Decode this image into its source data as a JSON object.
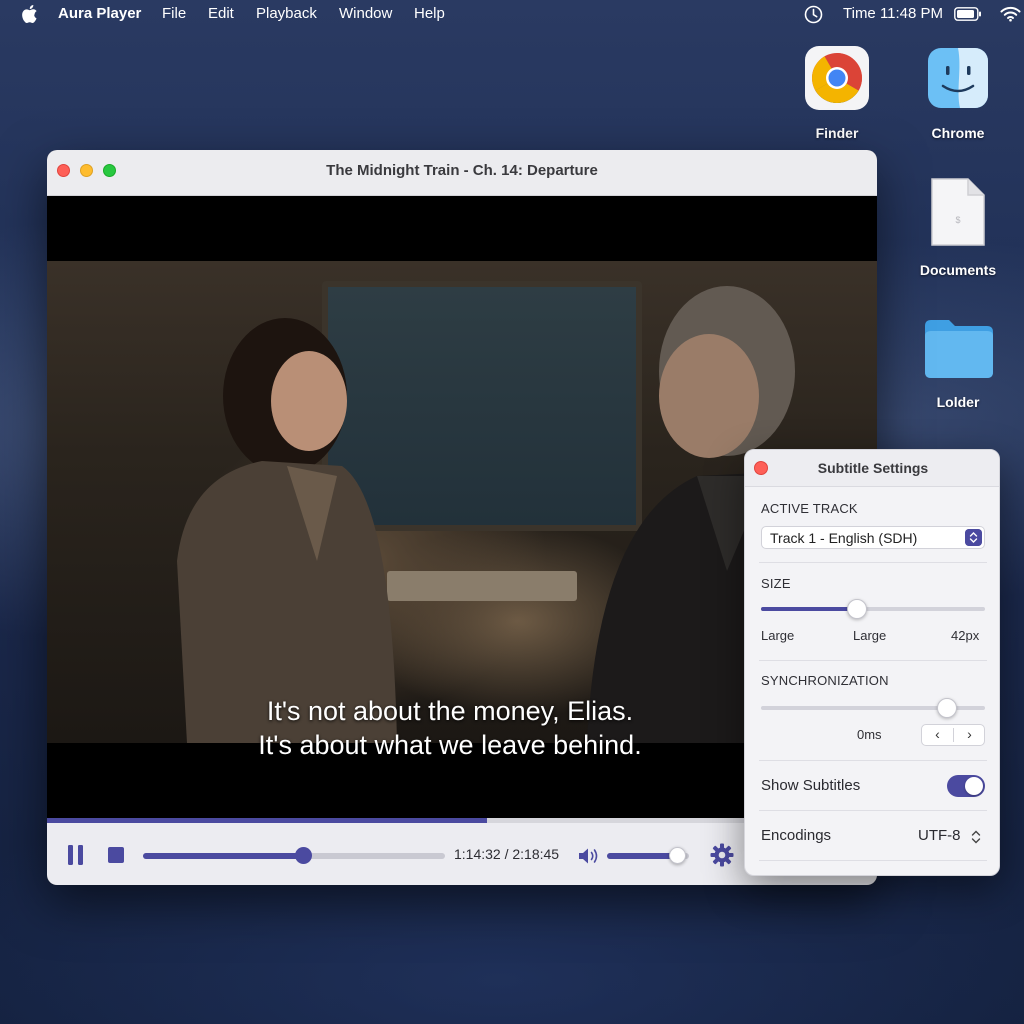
{
  "menubar": {
    "app_name": "Aura Player",
    "menus": [
      "File",
      "Edit",
      "Playback",
      "Window",
      "Help"
    ],
    "clock": "Time 11:48 PM"
  },
  "desktop": {
    "icons": [
      {
        "label": "Finder",
        "icon": "chrome-logo-icon"
      },
      {
        "label": "Chrome",
        "icon": "finder-face-icon"
      },
      {
        "label": "Documents",
        "icon": "document-file-icon"
      },
      {
        "label": "Lolder",
        "icon": "folder-icon"
      }
    ]
  },
  "player": {
    "title": "The Midnight Train - Ch. 14: Departure",
    "subtitle_lines": [
      "It's not about the money, Elias.",
      "It's about what we leave behind."
    ],
    "time_display": "1:14:32 / 2:18:45",
    "playback_progress": 0.53,
    "volume": 0.85,
    "accent_color": "#4b4aa0"
  },
  "subtitle_settings": {
    "title": "Subtitle Settings",
    "active_track_label": "ACTIVE TRACK",
    "active_track_value": "Track 1 - English (SDH)",
    "size_label": "SIZE",
    "size_min_label": "Large",
    "size_current_label": "Large",
    "size_value": "42px",
    "size_level": 0.43,
    "sync_label": "SYNCHRONIZATION",
    "sync_value": "0ms",
    "sync_level": 0.83,
    "nudge_left": "‹",
    "nudge_right": "›",
    "show_subtitles_label": "Show Subtitles",
    "show_subtitles_on": true,
    "encodings_label": "Encodings",
    "encodings_value": "UTF-8"
  }
}
